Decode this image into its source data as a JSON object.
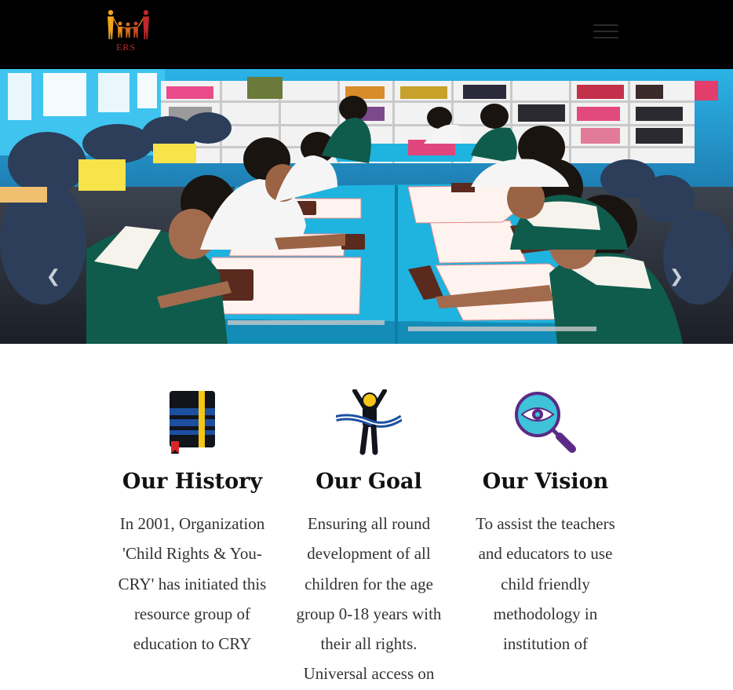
{
  "nav": {
    "logo_text": "ERS",
    "logo_icon": "family-logo-icon",
    "menu_icon": "hamburger-menu-icon"
  },
  "hero": {
    "image": "children-using-abacus-in-classroom-photo",
    "prev_icon": "chevron-left-icon",
    "next_icon": "chevron-right-icon",
    "prev_glyph": "❮",
    "next_glyph": "❯"
  },
  "features": [
    {
      "title": "Our History",
      "icon": "book-icon",
      "text": "In 2001, Organization 'Child Rights & You-CRY' has initiated this resource group of education to CRY"
    },
    {
      "title": "Our Goal",
      "icon": "finish-line-runner-icon",
      "text": "Ensuring all round development of all children for the age group 0-18 years with their all rights. Universal access on"
    },
    {
      "title": "Our Vision",
      "icon": "eye-magnifier-icon",
      "text": "To assist the teachers and educators to use child friendly methodology in institution of"
    }
  ],
  "colors": {
    "nav_bg": "#000000",
    "text": "#333333",
    "heading": "#111111",
    "book_blue": "#1d4fa0",
    "goal_yellow": "#f5c518",
    "vision_teal": "#3ec3d8",
    "vision_purple": "#5b2a86"
  }
}
